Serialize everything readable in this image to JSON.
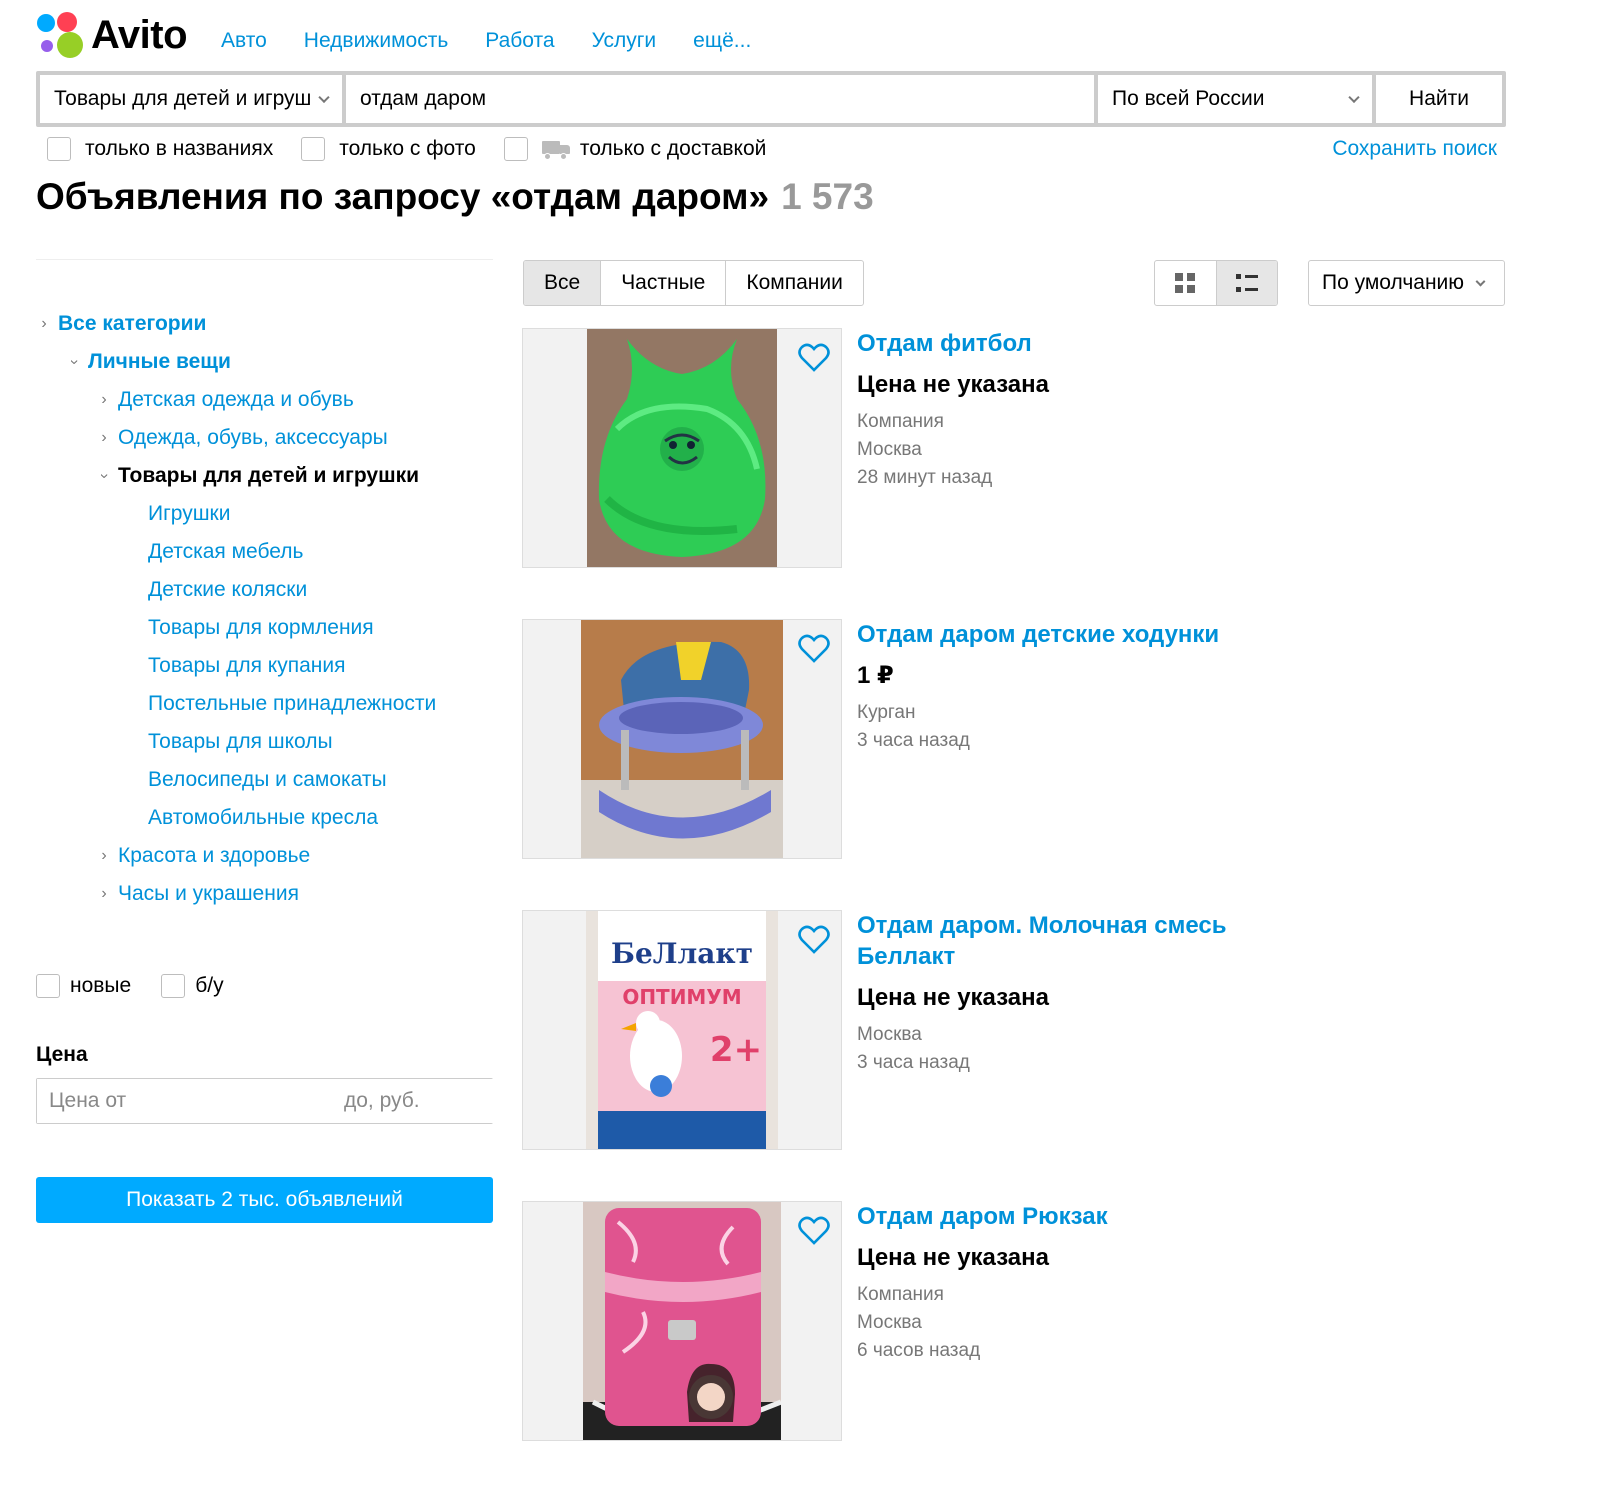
{
  "header": {
    "logo_text": "Avito",
    "nav": [
      "Авто",
      "Недвижимость",
      "Работа",
      "Услуги",
      "ещё..."
    ]
  },
  "search": {
    "category": "Товары для детей и игруш",
    "query": "отдам даром",
    "region": "По всей России",
    "button": "Найти"
  },
  "options": {
    "only_titles": "только в названиях",
    "only_photo": "только с фото",
    "only_delivery": "только с доставкой",
    "save_search": "Сохранить поиск"
  },
  "page": {
    "title": "Объявления по запросу «отдам даром»",
    "count": "1 573"
  },
  "sidebar": {
    "categories": [
      {
        "label": "Все категории",
        "level": 0,
        "arrow": "right",
        "style": "bold"
      },
      {
        "label": "Личные вещи",
        "level": 1,
        "arrow": "down",
        "style": "bold"
      },
      {
        "label": "Детская одежда и обувь",
        "level": 2,
        "arrow": "right",
        "style": "link"
      },
      {
        "label": "Одежда, обувь, аксессуары",
        "level": 2,
        "arrow": "right",
        "style": "link"
      },
      {
        "label": "Товары для детей и игрушки",
        "level": 2,
        "arrow": "down",
        "style": "current"
      },
      {
        "label": "Игрушки",
        "level": 3,
        "arrow": "",
        "style": "link"
      },
      {
        "label": "Детская мебель",
        "level": 3,
        "arrow": "",
        "style": "link"
      },
      {
        "label": "Детские коляски",
        "level": 3,
        "arrow": "",
        "style": "link"
      },
      {
        "label": "Товары для кормления",
        "level": 3,
        "arrow": "",
        "style": "link"
      },
      {
        "label": "Товары для купания",
        "level": 3,
        "arrow": "",
        "style": "link"
      },
      {
        "label": "Постельные принадлежности",
        "level": 3,
        "arrow": "",
        "style": "link"
      },
      {
        "label": "Товары для школы",
        "level": 3,
        "arrow": "",
        "style": "link"
      },
      {
        "label": "Велосипеды и самокаты",
        "level": 3,
        "arrow": "",
        "style": "link"
      },
      {
        "label": "Автомобильные кресла",
        "level": 3,
        "arrow": "",
        "style": "link"
      },
      {
        "label": "Красота и здоровье",
        "level": 2,
        "arrow": "right",
        "style": "link"
      },
      {
        "label": "Часы и украшения",
        "level": 2,
        "arrow": "right",
        "style": "link"
      }
    ],
    "condition_new": "новые",
    "condition_used": "б/у",
    "price_label": "Цена",
    "price_from_placeholder": "Цена от",
    "price_to_placeholder": "до, руб.",
    "show_button": "Показать 2 тыс. объявлений"
  },
  "filters": {
    "tabs": [
      "Все",
      "Частные",
      "Компании"
    ],
    "active_tab": "Все",
    "view_modes": [
      "grid-icon",
      "list-icon"
    ],
    "active_view": "list-icon",
    "sort": "По умолчанию"
  },
  "listings": [
    {
      "title": "Отдам фитбол",
      "price": "Цена не указана",
      "meta": [
        "Компания",
        "Москва",
        "28 минут назад"
      ],
      "photo": "green-fitball"
    },
    {
      "title": "Отдам даром детские ходунки",
      "price": "1 ₽",
      "meta": [
        "Курган",
        "3 часа назад"
      ],
      "photo": "baby-walker"
    },
    {
      "title": "Отдам даром. Молочная смесь Беллакт",
      "price": "Цена не указана",
      "meta": [
        "Москва",
        "3 часа назад"
      ],
      "photo": "formula-box"
    },
    {
      "title": "Отдам даром Рюкзак",
      "price": "Цена не указана",
      "meta": [
        "Компания",
        "Москва",
        "6 часов назад"
      ],
      "photo": "pink-backpack"
    }
  ],
  "photo_text": {
    "brand": "БеЛлакт",
    "product": "ОПТИМУМ",
    "age": "2+"
  },
  "colors": {
    "link": "#0091d9",
    "primary_button": "#00aaff",
    "muted": "#777777",
    "logo_blue": "#00aaff",
    "logo_red": "#ff4053",
    "logo_purple": "#965eeb",
    "logo_green": "#97cf26"
  }
}
